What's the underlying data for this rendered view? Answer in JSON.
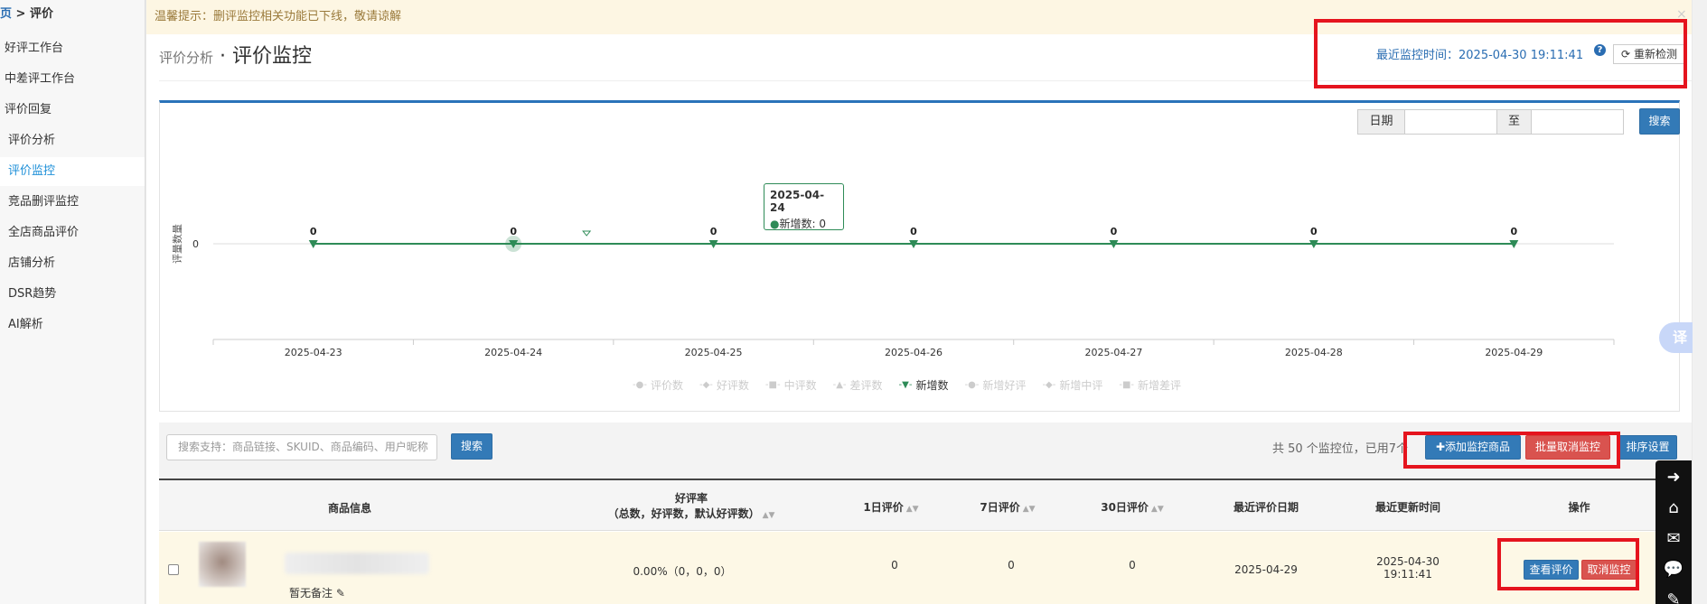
{
  "breadcrumb": {
    "home": "首页",
    "sep": " > ",
    "current": "评价"
  },
  "sidebar": {
    "items": [
      {
        "label": "好评工作台"
      },
      {
        "label": "中差评工作台"
      },
      {
        "label": "评价回复"
      },
      {
        "label": "评价分析"
      },
      {
        "label": "评价监控"
      },
      {
        "label": "竞品删评监控"
      },
      {
        "label": "全店商品评价"
      },
      {
        "label": "店铺分析"
      },
      {
        "label": "DSR趋势"
      },
      {
        "label": "AI解析"
      }
    ]
  },
  "warning": {
    "text": "温馨提示：删评监控相关功能已下线，敬请谅解",
    "close": "×"
  },
  "header": {
    "pre_title": "评价分析",
    "dot": " · ",
    "title": "评价监控",
    "monitor_time_label": "最近监控时间：",
    "monitor_time": "2025-04-30 19:11:41",
    "help": "?",
    "recheck_label": "重新检测",
    "recheck_icon": "refresh-icon"
  },
  "filters": {
    "date_label": "日期",
    "date_to": "至",
    "search_label": "搜索"
  },
  "chart_data": {
    "type": "line",
    "ylabel": "评量数量",
    "ylim": [
      0,
      0
    ],
    "y_tick": "0",
    "categories": [
      "2025-04-23",
      "2025-04-24",
      "2025-04-25",
      "2025-04-26",
      "2025-04-27",
      "2025-04-28",
      "2025-04-29"
    ],
    "series": [
      {
        "name": "新增数",
        "values": [
          0,
          0,
          0,
          0,
          0,
          0,
          0
        ],
        "color": "#2e8b57"
      }
    ],
    "legend": [
      {
        "label": "评价数",
        "active": false,
        "marker": "●"
      },
      {
        "label": "好评数",
        "active": false,
        "marker": "◆"
      },
      {
        "label": "中评数",
        "active": false,
        "marker": "■"
      },
      {
        "label": "差评数",
        "active": false,
        "marker": "▲"
      },
      {
        "label": "新增数",
        "active": true,
        "marker": "▼"
      },
      {
        "label": "新增好评",
        "active": false,
        "marker": "●"
      },
      {
        "label": "新增中评",
        "active": false,
        "marker": "◆"
      },
      {
        "label": "新增差评",
        "active": false,
        "marker": "■"
      }
    ],
    "tooltip": {
      "date": "2025-04-24",
      "label": "新增数: 0"
    },
    "highlight_index": 1
  },
  "toolbar": {
    "search_placeholder": "搜索支持：商品链接、SKUID、商品编码、用户昵称",
    "search_button": "搜索",
    "slot_info": "共 50 个监控位，已用7个",
    "add_button": "✚添加监控商品",
    "batch_cancel_button": "批量取消监控",
    "sort_button": "排序设置"
  },
  "table": {
    "columns": {
      "product": "商品信息",
      "rate_title": "好评率",
      "rate_sub": "（总数，好评数，默认好评数）",
      "d1": "1日评价",
      "d7": "7日评价",
      "d30": "30日评价",
      "last_review": "最近评价日期",
      "last_update": "最近更新时间",
      "ops": "操作"
    },
    "rows": [
      {
        "note": "暂无备注",
        "rate": "0.00%（0，0，0）",
        "d1": "0",
        "d7": "0",
        "d30": "0",
        "last_review": "2025-04-29",
        "last_update_date": "2025-04-30",
        "last_update_time": "19:11:41",
        "view_button": "查看评价",
        "cancel_button": "取消监控"
      }
    ]
  },
  "side_tools": [
    "arrow-right-icon",
    "home-icon",
    "mail-icon",
    "chat-icon",
    "edit-icon"
  ],
  "translate_label": "译",
  "colors": {
    "accent": "#337ab7",
    "danger": "#d9534f",
    "series": "#2e8b57",
    "highlight": "#e5141e"
  }
}
